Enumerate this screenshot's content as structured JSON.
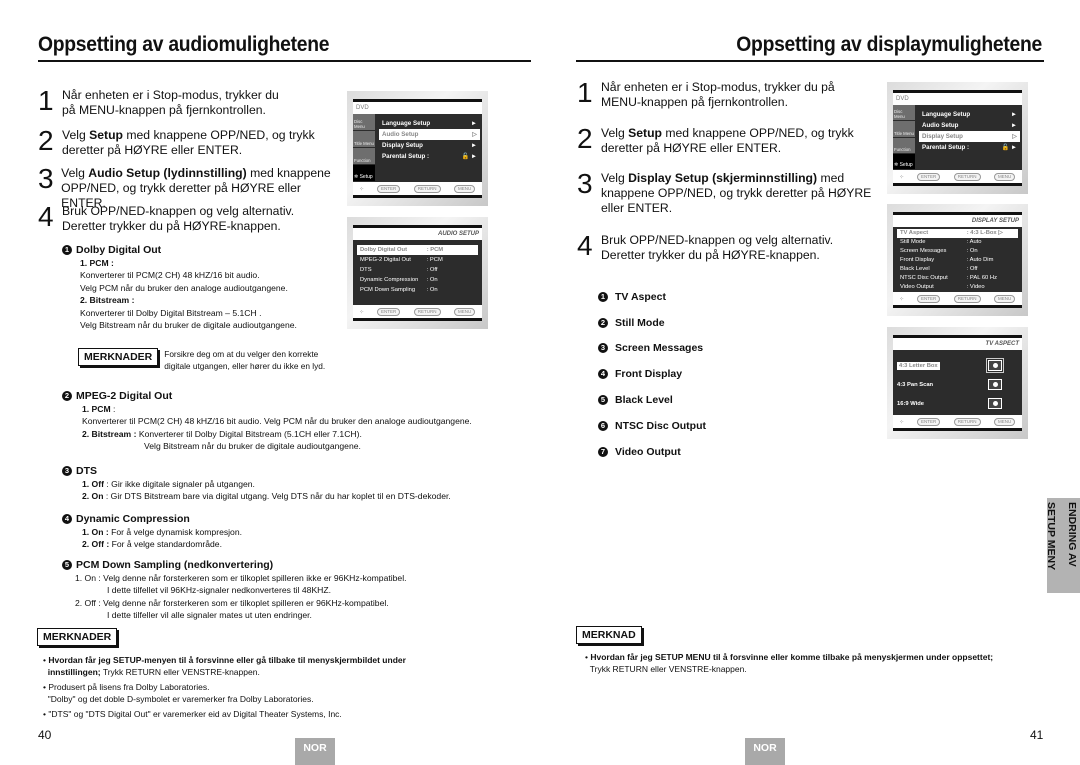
{
  "left": {
    "title": "Oppsetting av audiomulighetene",
    "steps": [
      {
        "num": "1",
        "pre": "Når enheten er i Stop-modus, trykker du",
        "line2": "på MENU-knappen på fjernkontrollen."
      },
      {
        "num": "2",
        "pre": "Velg ",
        "bold": "Setup",
        "post": " med knappene OPP/NED, og trykk",
        "line2": "deretter på HØYRE eller ENTER."
      },
      {
        "num": "3",
        "pre": "Velg ",
        "bold": "Audio Setup (lydinnstilling)",
        "post": " med knappene",
        "line2": "OPP/NED, og trykk deretter på HØYRE eller ENTER."
      },
      {
        "num": "4",
        "pre": "Bruk OPP/NED-knappen og velg alternativ.",
        "line2": "Deretter trykker du på HØYRE-knappen."
      }
    ],
    "sections": [
      {
        "badge": "1",
        "title": "Dolby Digital Out",
        "lines": [
          {
            "b": "1. PCM :",
            "t": ""
          },
          {
            "b": "",
            "t": "Konverterer til PCM(2 CH) 48 kHZ/16 bit audio."
          },
          {
            "b": "",
            "t": "Velg PCM når du bruker den analoge audioutgangene."
          },
          {
            "b": "2. Bitstream :",
            "t": ""
          },
          {
            "b": "",
            "t": "Konverterer til Dolby Digital Bitstream – 5.1CH ."
          },
          {
            "b": "",
            "t": "Velg Bitstream når du bruker de digitale audioutgangene."
          }
        ]
      },
      {
        "badge": "2",
        "title": "MPEG-2 Digital Out",
        "lines": [
          {
            "b": "1. PCM",
            "t": " :"
          },
          {
            "b": "",
            "t": "Konverterer til PCM(2 CH) 48 kHZ/16 bit audio. Velg PCM når du bruker den analoge audioutgangene."
          },
          {
            "b": "2. Bitstream :",
            "t": " Konverterer til Dolby Digital Bitstream (5.1CH eller 7.1CH)."
          },
          {
            "b": "",
            "t": "Velg Bitstream når du bruker de digitale audioutgangene."
          }
        ]
      },
      {
        "badge": "3",
        "title": "DTS",
        "lines": [
          {
            "b": "1. Off",
            "t": " : Gir ikke digitale signaler på utgangen."
          },
          {
            "b": "2. On",
            "t": " : Gir DTS Bitstream bare via digital utgang. Velg DTS når du har koplet til en DTS-dekoder."
          }
        ]
      },
      {
        "badge": "4",
        "title": "Dynamic Compression",
        "lines": [
          {
            "b": "1. On :",
            "t": " For å velge dynamisk kompresjon."
          },
          {
            "b": "2. Off :",
            "t": "  For å velge standardområde."
          }
        ]
      },
      {
        "badge": "5",
        "title": "PCM Down Sampling (nedkonvertering)",
        "lines": [
          {
            "b": "",
            "t": "1. On : Velg denne når forsterkeren som er tilkoplet spilleren ikke er 96KHz-kompatibel."
          },
          {
            "b": "",
            "t": "I dette tilfellet vil 96KHz-signaler nedkonverteres til 48KHZ."
          },
          {
            "b": "",
            "t": "2. Off : Velg denne når forsterkeren som er tilkoplet spilleren er 96KHz-kompatibel."
          },
          {
            "b": "",
            "t": "I dette tilfeller vil alle signaler mates ut uten endringer."
          }
        ]
      }
    ],
    "inline_note": {
      "label": "MERKNADER",
      "line1": "Forsikre deg om at du velger den  korrekte",
      "line2": "digitale utgangen, eller hører du ikke en lyd."
    },
    "notes": {
      "label": "MERKNADER",
      "bullets": [
        {
          "bold": "Hvordan får jeg SETUP-menyen til å forsvinne eller gå tilbake til menyskjermbildet under",
          "bold2": "innstillingen;",
          "text": " Trykk RETURN eller VENSTRE-knappen."
        },
        {
          "bold": "",
          "bold2": "",
          "text": "Produsert på lisens fra Dolby Laboratories.",
          "line2": "\"Dolby\" og det doble D-symbolet er varemerker fra Dolby Laboratories."
        },
        {
          "bold": "",
          "bold2": "",
          "text": "\"DTS\" og \"DTS Digital Out\" er varemerker eid av Digital Theater Systems, Inc."
        }
      ]
    },
    "page_number": "40",
    "lang_tab": "NOR",
    "screen1": {
      "top": "DVD",
      "side": [
        "Disc Menu",
        "Title Menu",
        "Function",
        "Setup"
      ],
      "menu": [
        {
          "label": "Language Setup",
          "arrow": "►"
        },
        {
          "label": "Audio Setup",
          "arrow": "▷"
        },
        {
          "label": "Display Setup",
          "arrow": "►"
        },
        {
          "label": "Parental Setup :",
          "arrow": "🔓 ►"
        }
      ],
      "footer": [
        "ENTER",
        "RETURN",
        "MENU"
      ]
    },
    "screen2": {
      "top": "AUDIO SETUP",
      "rows": [
        {
          "k": "Dolby Digital Out",
          "v": ": PCM"
        },
        {
          "k": "MPEG-2 Digital Out",
          "v": ": PCM"
        },
        {
          "k": "DTS",
          "v": ": Off"
        },
        {
          "k": "Dynamic Compression",
          "v": ": On"
        },
        {
          "k": "PCM Down Sampling",
          "v": ": On"
        }
      ],
      "footer": [
        "ENTER",
        "RETURN",
        "MENU"
      ]
    }
  },
  "right": {
    "title": "Oppsetting av displaymulighetene",
    "steps": [
      {
        "num": "1",
        "pre": "Når enheten er i Stop-modus, trykker du på",
        "line2": "MENU-knappen på fjernkontrollen."
      },
      {
        "num": "2",
        "pre": "Velg ",
        "bold": "Setup",
        "post": " med knappene OPP/NED, og trykk",
        "line2": "deretter på HØYRE eller ENTER."
      },
      {
        "num": "3",
        "pre": "Velg ",
        "bold": "Display Setup (skjerminnstilling)",
        "post": " med",
        "line2": "knappene OPP/NED, og trykk deretter på HØYRE",
        "line3": "eller ENTER."
      },
      {
        "num": "4",
        "pre": "Bruk OPP/NED-knappen og velg alternativ.",
        "line2": "Deretter trykker du på HØYRE-knappen."
      }
    ],
    "options": [
      {
        "badge": "1",
        "label": "TV Aspect"
      },
      {
        "badge": "2",
        "label": "Still Mode"
      },
      {
        "badge": "3",
        "label": "Screen Messages"
      },
      {
        "badge": "4",
        "label": "Front Display"
      },
      {
        "badge": "5",
        "label": "Black Level"
      },
      {
        "badge": "6",
        "label": "NTSC Disc Output"
      },
      {
        "badge": "7",
        "label": "Video Output"
      }
    ],
    "notes": {
      "label": "MERKNAD",
      "bold": "Hvordan får jeg SETUP MENU til å forsvinne eller komme tilbake på menyskjermen under oppsettet;",
      "text": "Trykk RETURN eller VENSTRE-knappen."
    },
    "side_tab": {
      "line1": "ENDRING AV",
      "line2": "SETUP MENY"
    },
    "page_number": "41",
    "lang_tab": "NOR",
    "screen1": {
      "top": "DVD",
      "side": [
        "Disc Menu",
        "Title Menu",
        "Function",
        "Setup"
      ],
      "menu": [
        {
          "label": "Language Setup",
          "arrow": "►"
        },
        {
          "label": "Audio Setup",
          "arrow": "►"
        },
        {
          "label": "Display Setup",
          "arrow": "▷"
        },
        {
          "label": "Parental Setup :",
          "arrow": "🔓 ►"
        }
      ],
      "footer": [
        "ENTER",
        "RETURN",
        "MENU"
      ]
    },
    "screen2": {
      "top": "DISPLAY SETUP",
      "rows": [
        {
          "k": "TV Aspect",
          "v": ": 4:3 L-Box  ▷"
        },
        {
          "k": "Still Mode",
          "v": ": Auto"
        },
        {
          "k": "Screen Messages",
          "v": ": On"
        },
        {
          "k": "Front Display",
          "v": ": Auto Dim"
        },
        {
          "k": "Black Level",
          "v": ": Off"
        },
        {
          "k": "NTSC Disc Output",
          "v": ": PAL 60 Hz"
        },
        {
          "k": "Video Output",
          "v": ": Video"
        }
      ],
      "footer": [
        "ENTER",
        "RETURN",
        "MENU"
      ]
    },
    "screen3": {
      "top": "TV ASPECT",
      "rows": [
        "4:3 Letter Box",
        "4:3 Pan Scan",
        "16:9 Wide"
      ],
      "footer": [
        "ENTER",
        "RETURN",
        "MENU"
      ]
    }
  }
}
